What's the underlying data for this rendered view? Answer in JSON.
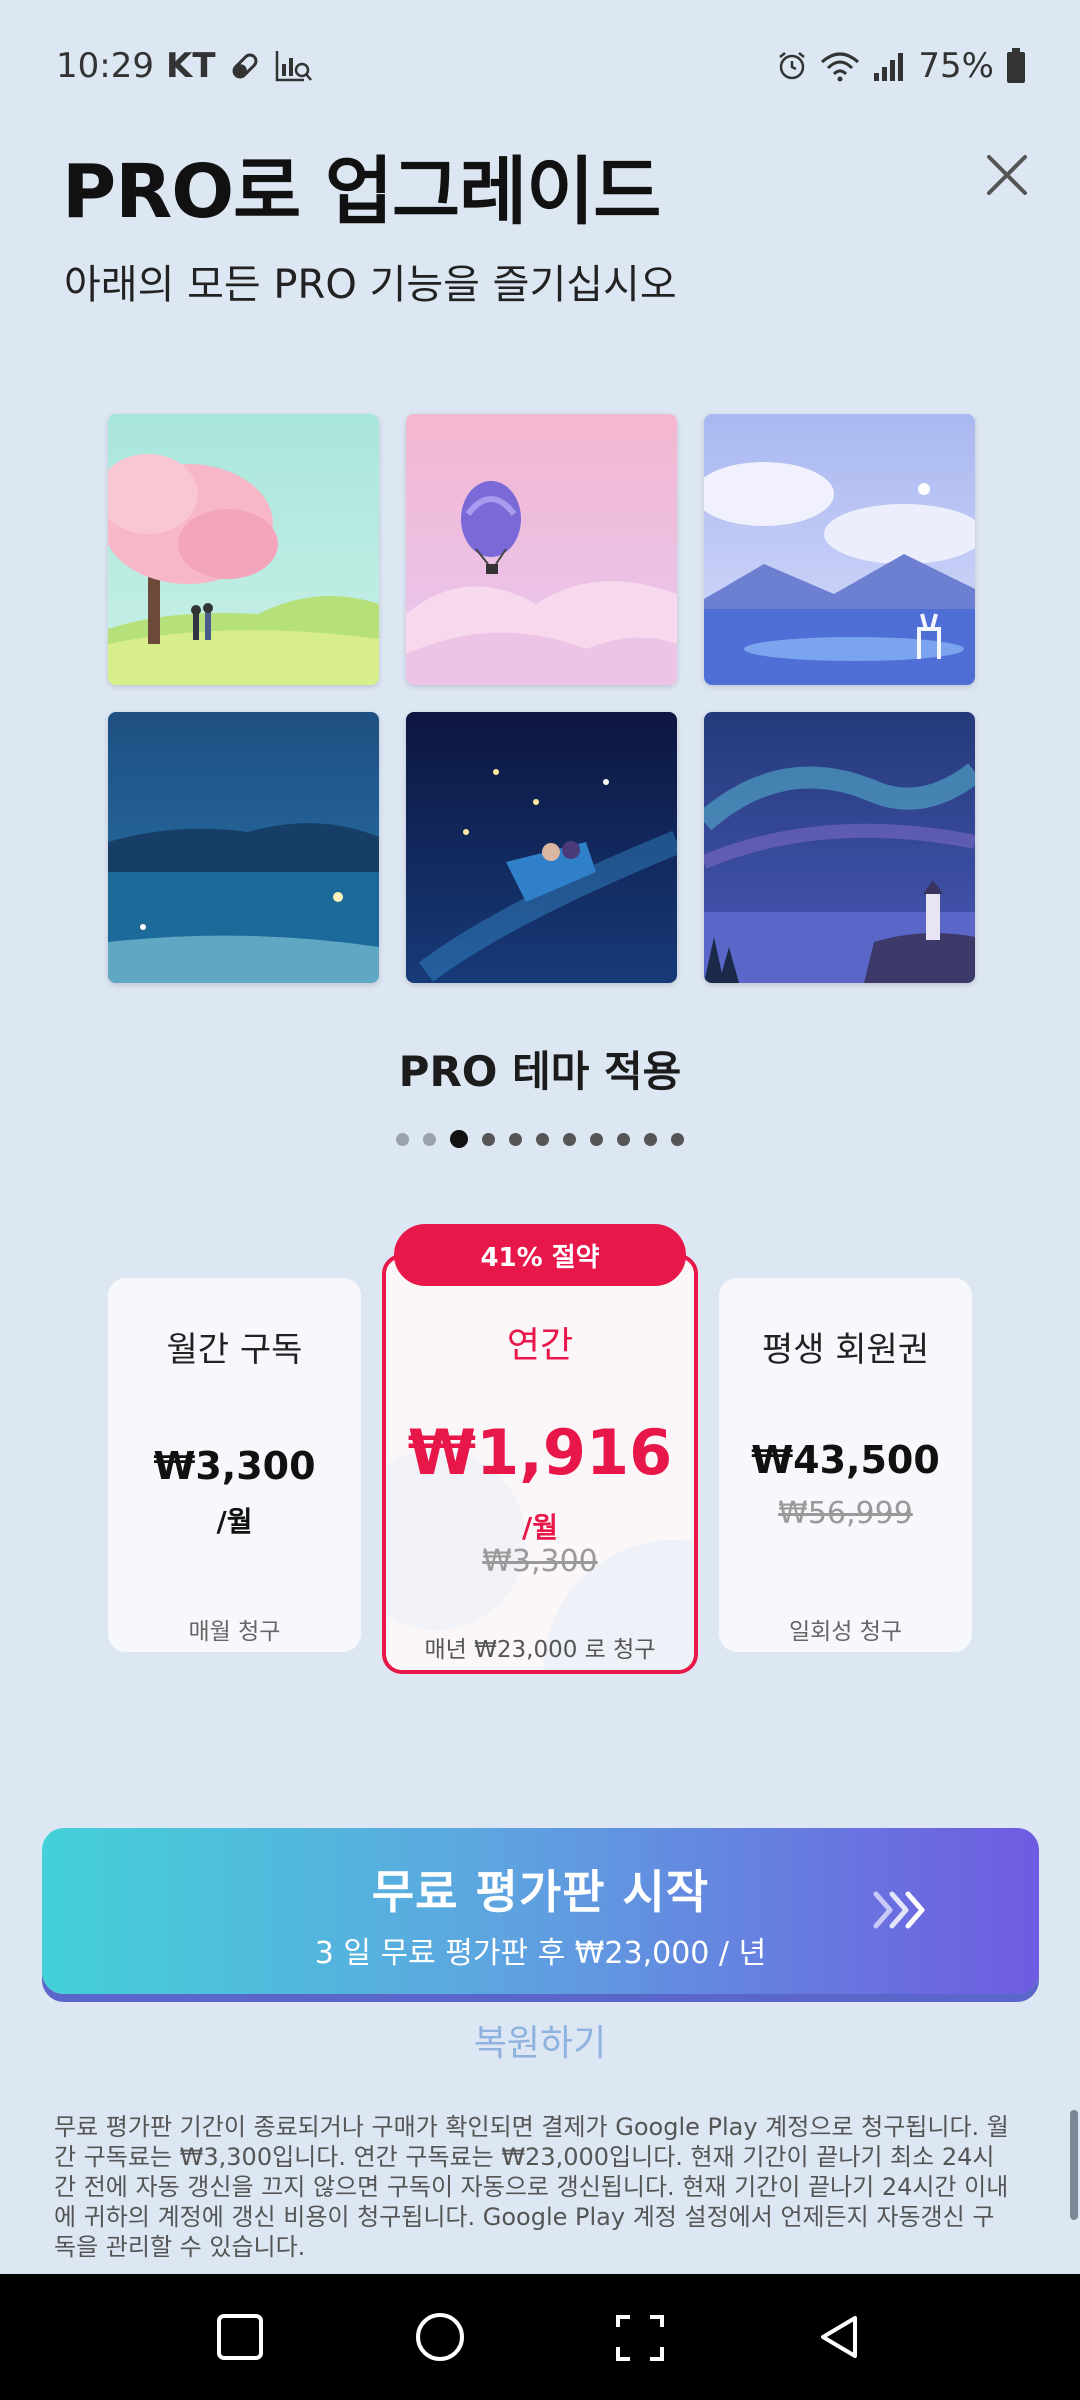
{
  "status_bar": {
    "time": "10:29",
    "carrier": "KT",
    "battery": "75%"
  },
  "header": {
    "title": "PRO로 업그레이드",
    "subtitle": "아래의 모든 PRO 기능을 즐기십시오"
  },
  "themes": [
    {
      "icon": "cherry-blossom-theme"
    },
    {
      "icon": "hot-air-balloon-theme"
    },
    {
      "icon": "deer-lake-theme"
    },
    {
      "icon": "crescent-moon-theme"
    },
    {
      "icon": "night-boat-theme"
    },
    {
      "icon": "aurora-lighthouse-theme"
    }
  ],
  "feature_caption": "PRO 테마 적용",
  "carousel": {
    "count": 11,
    "active_index": 2
  },
  "plans": {
    "save_badge": "41% 절약",
    "monthly": {
      "name": "월간 구독",
      "price": "₩3,300",
      "unit": "/월",
      "note": "매월 청구"
    },
    "annual": {
      "name": "연간",
      "price": "₩1,916",
      "unit": "/월",
      "old_price": "₩3,300",
      "note": "매년 ₩23,000 로 청구"
    },
    "lifetime": {
      "name": "평생 회원권",
      "price": "₩43,500",
      "old_price": "₩56,999",
      "note": "일회성 청구"
    }
  },
  "cta": {
    "title": "무료 평가판 시작",
    "subtitle": "3 일 무료 평가판 후 ₩23,000 / 년"
  },
  "restore_label": "복원하기",
  "legal": "무료 평가판 기간이 종료되거나 구매가 확인되면 결제가 Google Play 계정으로 청구됩니다. 월간 구독료는 ₩3,300입니다. 연간 구독료는 ₩23,000입니다. 현재 기간이 끝나기 최소 24시간 전에 자동 갱신을 끄지 않으면 구독이 자동으로 갱신됩니다. 현재 기간이 끝나기 24시간 이내에 귀하의 계정에 갱신 비용이 청구됩니다. Google Play 계정 설정에서 언제든지 자동갱신 구독을 관리할 수 있습니다.",
  "colors": {
    "accent": "#e8174a",
    "background": "#dde7f3",
    "cta_start": "#44d1d8",
    "cta_end": "#6f5be0",
    "restore": "#8fb2df"
  }
}
